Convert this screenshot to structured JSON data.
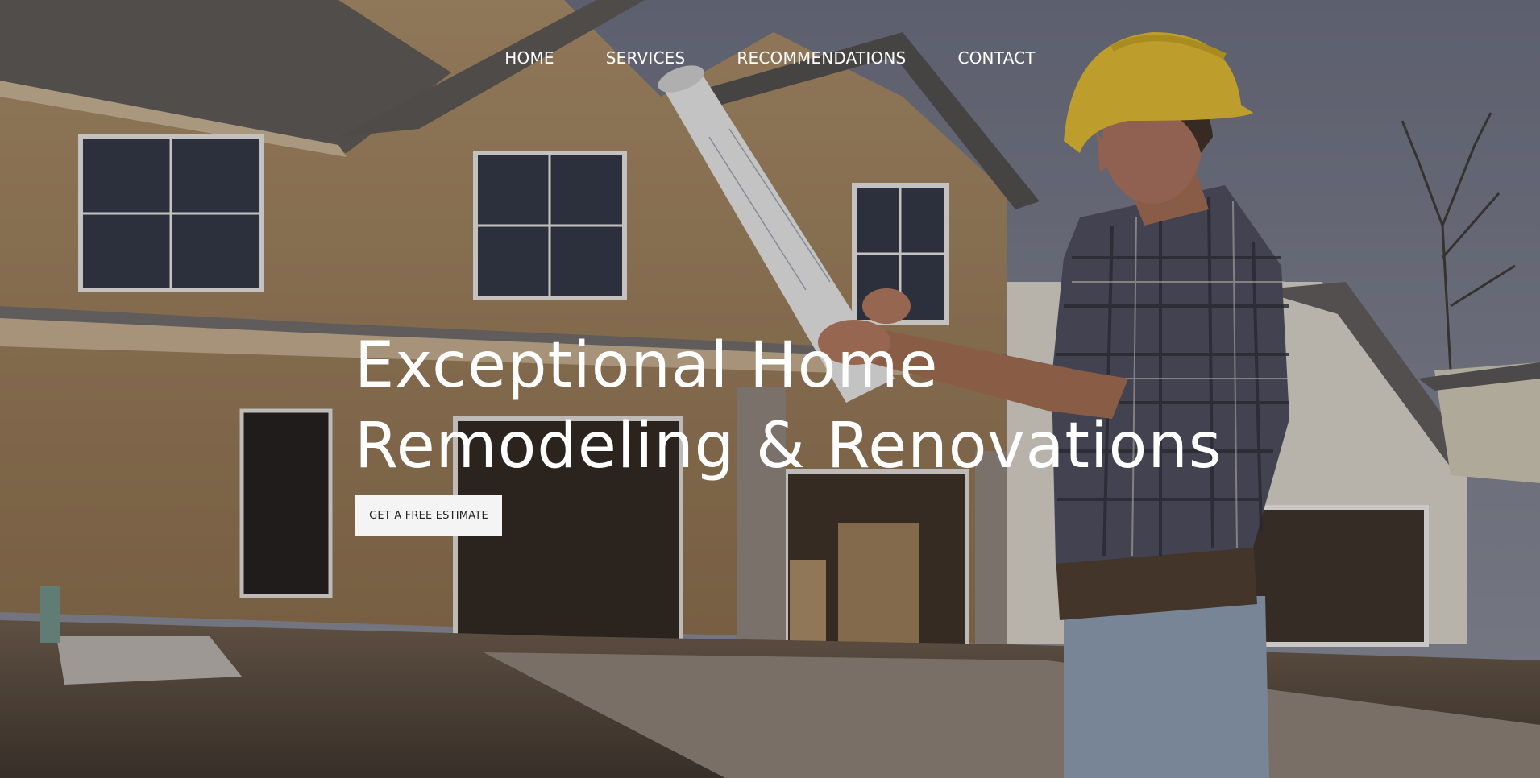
{
  "nav": {
    "items": [
      {
        "label": "HOME"
      },
      {
        "label": "SERVICES"
      },
      {
        "label": "RECOMMENDATIONS"
      },
      {
        "label": "CONTACT"
      }
    ]
  },
  "hero": {
    "headline_line1": "Exceptional Home",
    "headline_line2": "Remodeling & Renovations",
    "cta_label": "GET A FREE ESTIMATE",
    "background_description_icon": "construction-house-photo"
  },
  "colors": {
    "text": "#ffffff",
    "cta_bg": "#f4f4f4",
    "cta_text": "#222222"
  }
}
